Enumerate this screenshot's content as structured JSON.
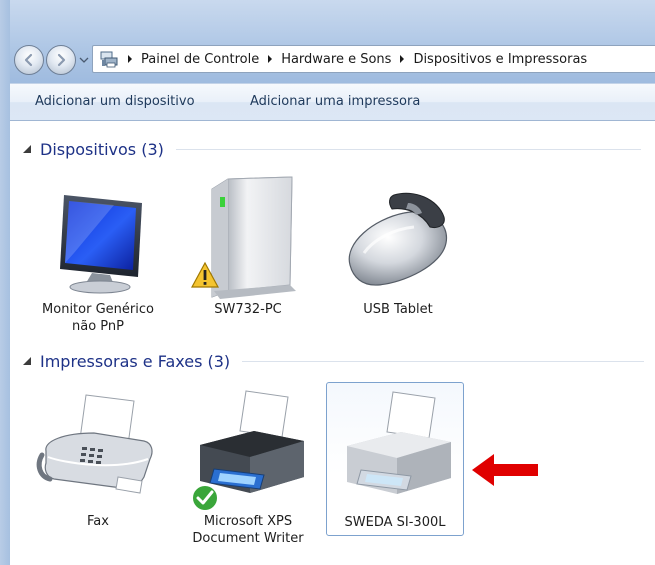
{
  "breadcrumb": [
    "Painel de Controle",
    "Hardware e Sons",
    "Dispositivos e Impressoras"
  ],
  "commands": {
    "add_device": "Adicionar um dispositivo",
    "add_printer": "Adicionar uma impressora"
  },
  "groups": {
    "devices": {
      "title": "Dispositivos (3)",
      "items": [
        {
          "name": "Monitor Genérico não PnP",
          "line1": "Monitor Genérico",
          "line2": "não PnP",
          "icon": "monitor-icon"
        },
        {
          "name": "SW732-PC",
          "line1": "SW732-PC",
          "icon": "computer-tower-icon",
          "badge": "warning-icon"
        },
        {
          "name": "USB Tablet",
          "line1": "USB Tablet",
          "icon": "mouse-icon"
        }
      ]
    },
    "printers": {
      "title": "Impressoras e Faxes (3)",
      "items": [
        {
          "name": "Fax",
          "line1": "Fax",
          "icon": "fax-icon"
        },
        {
          "name": "Microsoft XPS Document Writer",
          "line1": "Microsoft XPS",
          "line2": "Document Writer",
          "icon": "printer-icon",
          "badge": "default-check-icon"
        },
        {
          "name": "SWEDA SI-300L",
          "line1": "SWEDA SI-300L",
          "icon": "printer-icon",
          "selected": true
        }
      ]
    }
  },
  "colors": {
    "group_title": "#1e3287",
    "command_text": "#1e395b",
    "selection_border": "#7da2ce",
    "annotation_arrow": "#e00000",
    "default_check": "#3aa63a"
  }
}
